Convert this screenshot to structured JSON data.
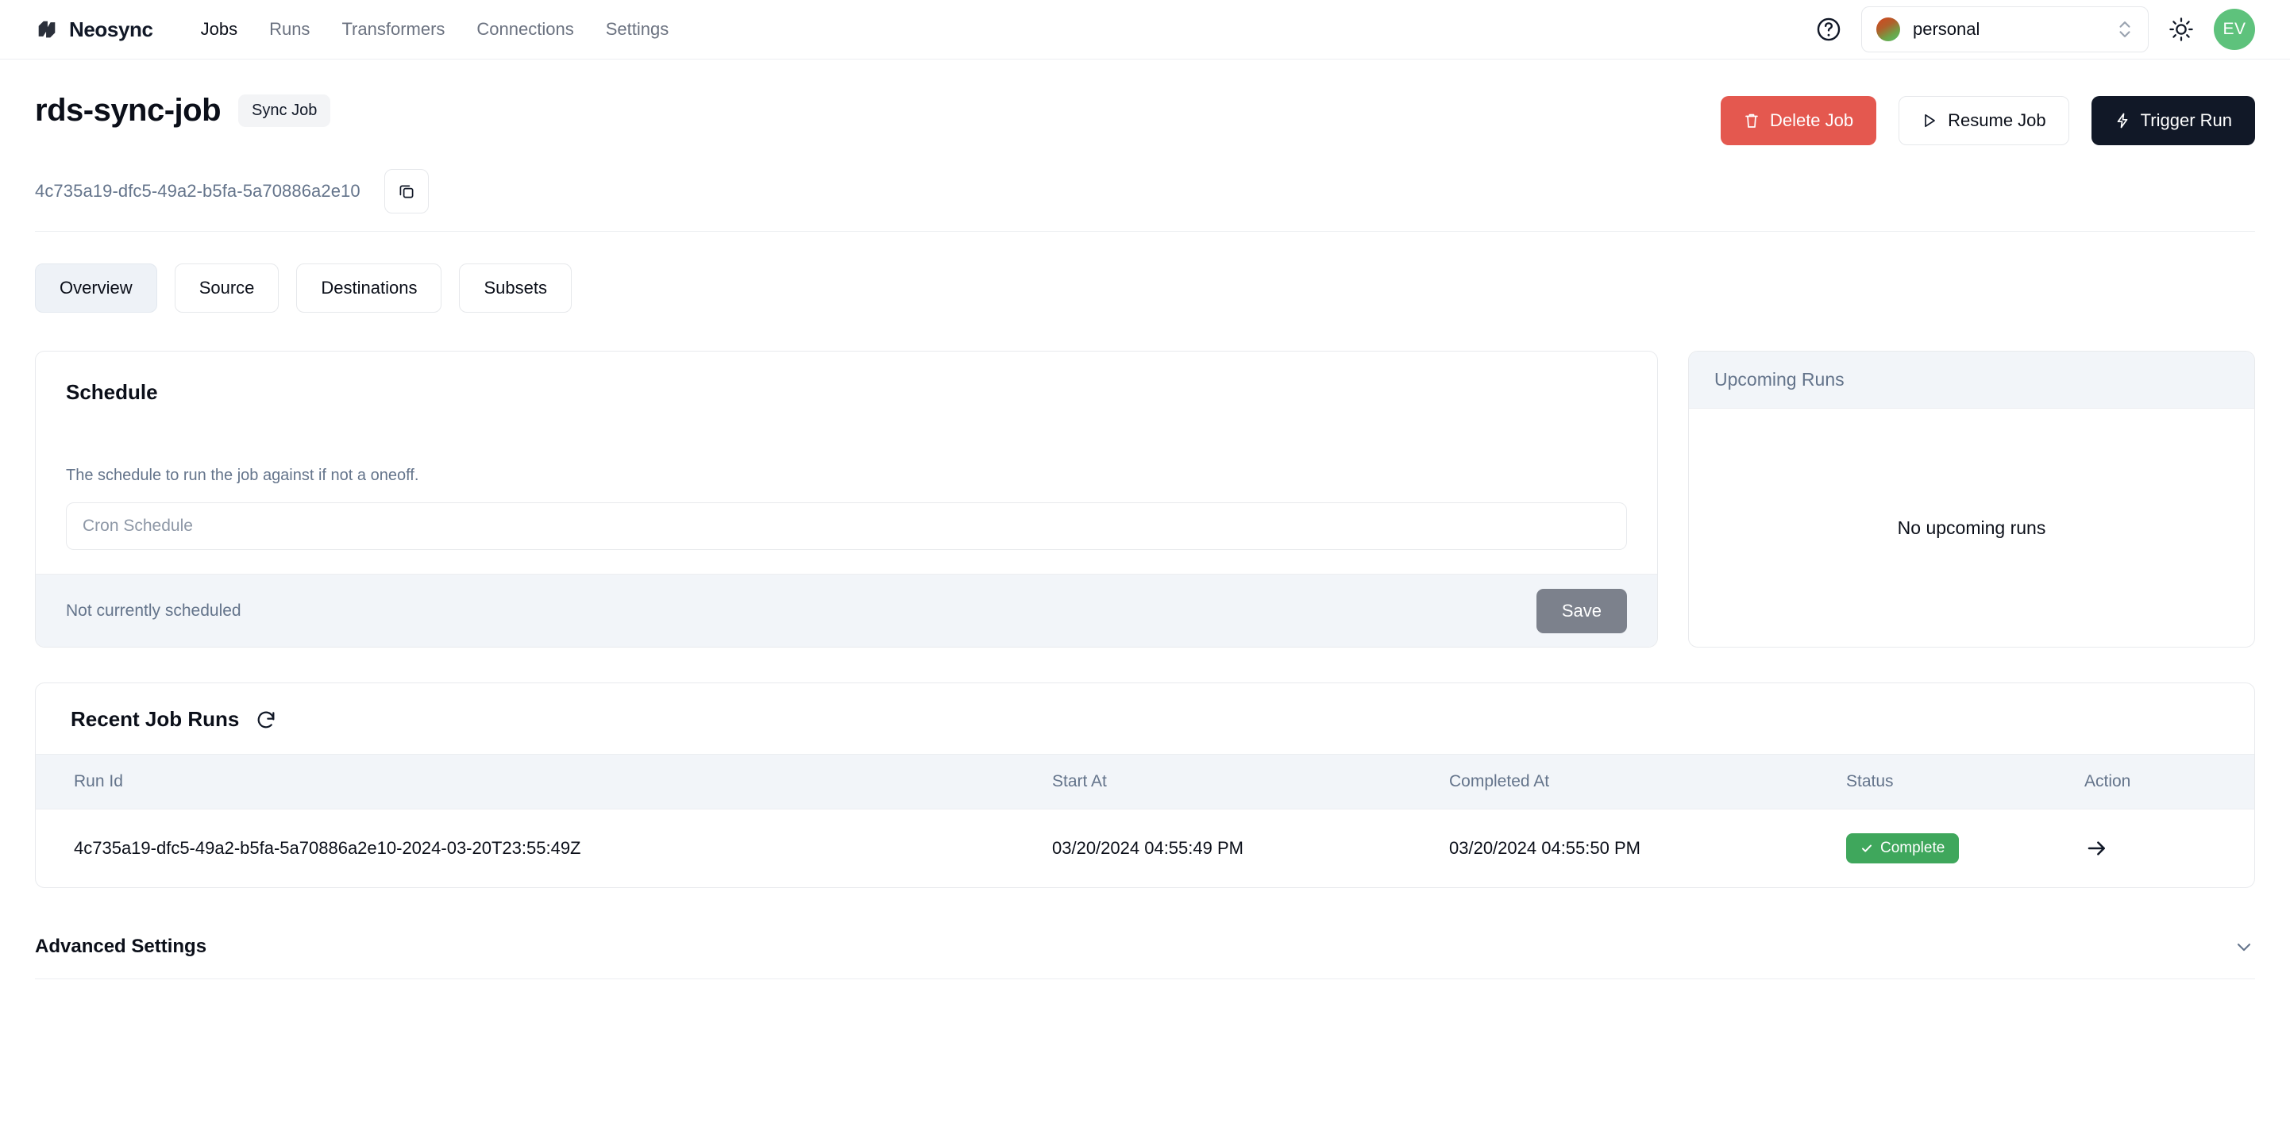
{
  "nav": {
    "brand": "Neosync",
    "brand_logo_icon": "neosync-logo-icon",
    "links": [
      {
        "label": "Jobs",
        "active": true
      },
      {
        "label": "Runs",
        "active": false
      },
      {
        "label": "Transformers",
        "active": false
      },
      {
        "label": "Connections",
        "active": false
      },
      {
        "label": "Settings",
        "active": false
      }
    ],
    "help_icon": "help-circle-icon",
    "account": {
      "name": "personal",
      "dot_colors": [
        "#d4451f",
        "#58c06a"
      ],
      "chevron_icon": "chevrons-up-down-icon"
    },
    "theme_toggle_icon": "sun-icon",
    "avatar_initials": "EV",
    "avatar_color": "#5ec27c"
  },
  "job": {
    "title": "rds-sync-job",
    "badge": "Sync Job",
    "id": "4c735a19-dfc5-49a2-b5fa-5a70886a2e10",
    "copy_icon": "copy-icon",
    "actions": [
      {
        "label": "Delete Job",
        "icon": "trash-icon",
        "variant": "danger",
        "color": "#e4584f"
      },
      {
        "label": "Resume Job",
        "icon": "play-icon",
        "variant": "outline",
        "color": "#ffffff"
      },
      {
        "label": "Trigger Run",
        "icon": "lightning-icon",
        "variant": "dark",
        "color": "#111827"
      }
    ]
  },
  "tabs": [
    {
      "label": "Overview",
      "active": true
    },
    {
      "label": "Source",
      "active": false
    },
    {
      "label": "Destinations",
      "active": false
    },
    {
      "label": "Subsets",
      "active": false
    }
  ],
  "schedule": {
    "title": "Schedule",
    "description": "The schedule to run the job against if not a oneoff.",
    "cron_value": "",
    "cron_placeholder": "Cron Schedule",
    "status_note": "Not currently scheduled",
    "save_label": "Save"
  },
  "upcoming_runs": {
    "title": "Upcoming Runs",
    "empty_message": "No upcoming runs"
  },
  "recent_runs": {
    "title": "Recent Job Runs",
    "refresh_icon": "refresh-icon",
    "columns": [
      "Run Id",
      "Start At",
      "Completed At",
      "Status",
      "Action"
    ],
    "rows": [
      {
        "run_id": "4c735a19-dfc5-49a2-b5fa-5a70886a2e10-2024-03-20T23:55:49Z",
        "start_at": "03/20/2024 04:55:49 PM",
        "completed_at": "03/20/2024 04:55:50 PM",
        "status": "Complete",
        "status_color": "#3fa75c",
        "status_icon": "check-icon",
        "action_icon": "arrow-right-icon"
      }
    ]
  },
  "advanced_settings": {
    "title": "Advanced Settings",
    "chevron_icon": "chevron-down-icon"
  }
}
